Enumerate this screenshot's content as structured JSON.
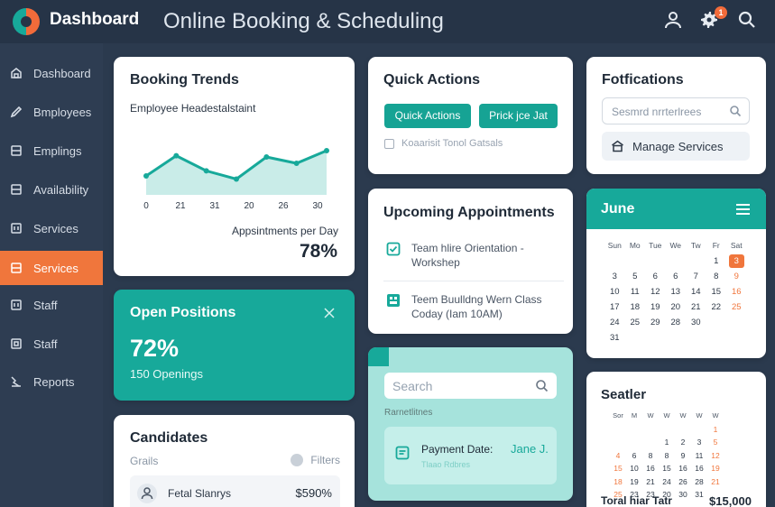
{
  "header": {
    "brand": "Dashboard",
    "title": "Online Booking & Scheduling",
    "notification_count": "1"
  },
  "sidebar": {
    "items": [
      {
        "label": "Dashboard",
        "icon": "home-icon"
      },
      {
        "label": "Bmployees",
        "icon": "pencil-icon"
      },
      {
        "label": "Emplings",
        "icon": "list-icon"
      },
      {
        "label": "Availability",
        "icon": "list-icon"
      },
      {
        "label": "Services",
        "icon": "grid-icon"
      },
      {
        "label": "Services",
        "icon": "list-icon",
        "active": true
      },
      {
        "label": "Staff",
        "icon": "grid-icon"
      },
      {
        "label": "Staff",
        "icon": "square-icon"
      },
      {
        "label": "Reports",
        "icon": "chart-icon"
      }
    ]
  },
  "booking_trends": {
    "title": "Booking Trends",
    "subtitle": "Employee Headestalstaint",
    "caption": "Appsintments per Day",
    "percent": "78%"
  },
  "chart_data": {
    "type": "area",
    "title": "Booking Trends",
    "subtitle": "Employee Headestalstaint",
    "x_ticks": [
      "0",
      "21",
      "31",
      "20",
      "26",
      "30"
    ],
    "points": [
      {
        "x": 0,
        "y": 30
      },
      {
        "x": 1,
        "y": 62
      },
      {
        "x": 2,
        "y": 38
      },
      {
        "x": 3,
        "y": 25
      },
      {
        "x": 4,
        "y": 60
      },
      {
        "x": 5,
        "y": 50
      },
      {
        "x": 6,
        "y": 70
      }
    ],
    "ylim": [
      0,
      100
    ],
    "grid": false,
    "colors": {
      "line": "#17a99a",
      "fill": "#c9ece8"
    }
  },
  "quick_actions": {
    "title": "Quick Actions",
    "button1": "Quick Actions",
    "button2": "Prick jce Jat",
    "note": "Koaarisit Tonol Gatsals"
  },
  "notifications": {
    "title": "Fotfications",
    "search_placeholder": "Sesmrd nrrterlrees",
    "manage_label": "Manage Services"
  },
  "upcoming": {
    "title": "Upcoming Appointments",
    "items": [
      {
        "line1": "Team hlire Orientation -",
        "line2": "Workshep"
      },
      {
        "line1": "Teem Buulldng Wern Class",
        "line2": "Coday (Iam 10AM)"
      }
    ]
  },
  "open_positions": {
    "title": "Open Positions",
    "percent": "72%",
    "openings": "150 Openings"
  },
  "calendar_june": {
    "month": "June",
    "weekdays": [
      "Sun",
      "Mo",
      "Tue",
      "We",
      "Tw",
      "Fr",
      "Sat"
    ],
    "rows": [
      [
        "",
        "",
        "",
        "",
        "",
        "1",
        "3"
      ],
      [
        "3",
        "5",
        "6",
        "6",
        "7",
        "8",
        "9"
      ],
      [
        "10",
        "11",
        "12",
        "13",
        "14",
        "15",
        "16"
      ],
      [
        "17",
        "18",
        "19",
        "20",
        "21",
        "22",
        "25"
      ],
      [
        "24",
        "25",
        "29",
        "28",
        "30",
        "",
        ""
      ],
      [
        "31",
        "",
        "",
        "",
        "",
        "",
        ""
      ]
    ]
  },
  "search_panel": {
    "placeholder": "Search",
    "label": "Rarnetlitnes",
    "payment_label": "Payment Date:",
    "payment_name": "Jane J.",
    "payment_sub": "Tlaao Rdbres"
  },
  "candidates": {
    "title": "Candidates",
    "col_left": "Grails",
    "filters": "Filters",
    "row_name": "Fetal Slanrys",
    "row_value": "$590%"
  },
  "calendar_small": {
    "title": "Seatler",
    "weekdays": [
      "Sor",
      "M",
      "W",
      "W",
      "W",
      "W",
      "W"
    ],
    "rows": [
      [
        "",
        "",
        "",
        "",
        "",
        "",
        "1"
      ],
      [
        "",
        "",
        "",
        "1",
        "2",
        "3",
        "5"
      ],
      [
        "4",
        "6",
        "8",
        "8",
        "9",
        "11",
        "12"
      ],
      [
        "15",
        "10",
        "16",
        "15",
        "16",
        "16",
        "19"
      ],
      [
        "18",
        "19",
        "21",
        "24",
        "26",
        "28",
        "21"
      ],
      [
        "25",
        "23",
        "23",
        "20",
        "30",
        "31",
        ""
      ]
    ],
    "total_label": "Toral hiar Tatr",
    "total_value": "$15,000"
  }
}
